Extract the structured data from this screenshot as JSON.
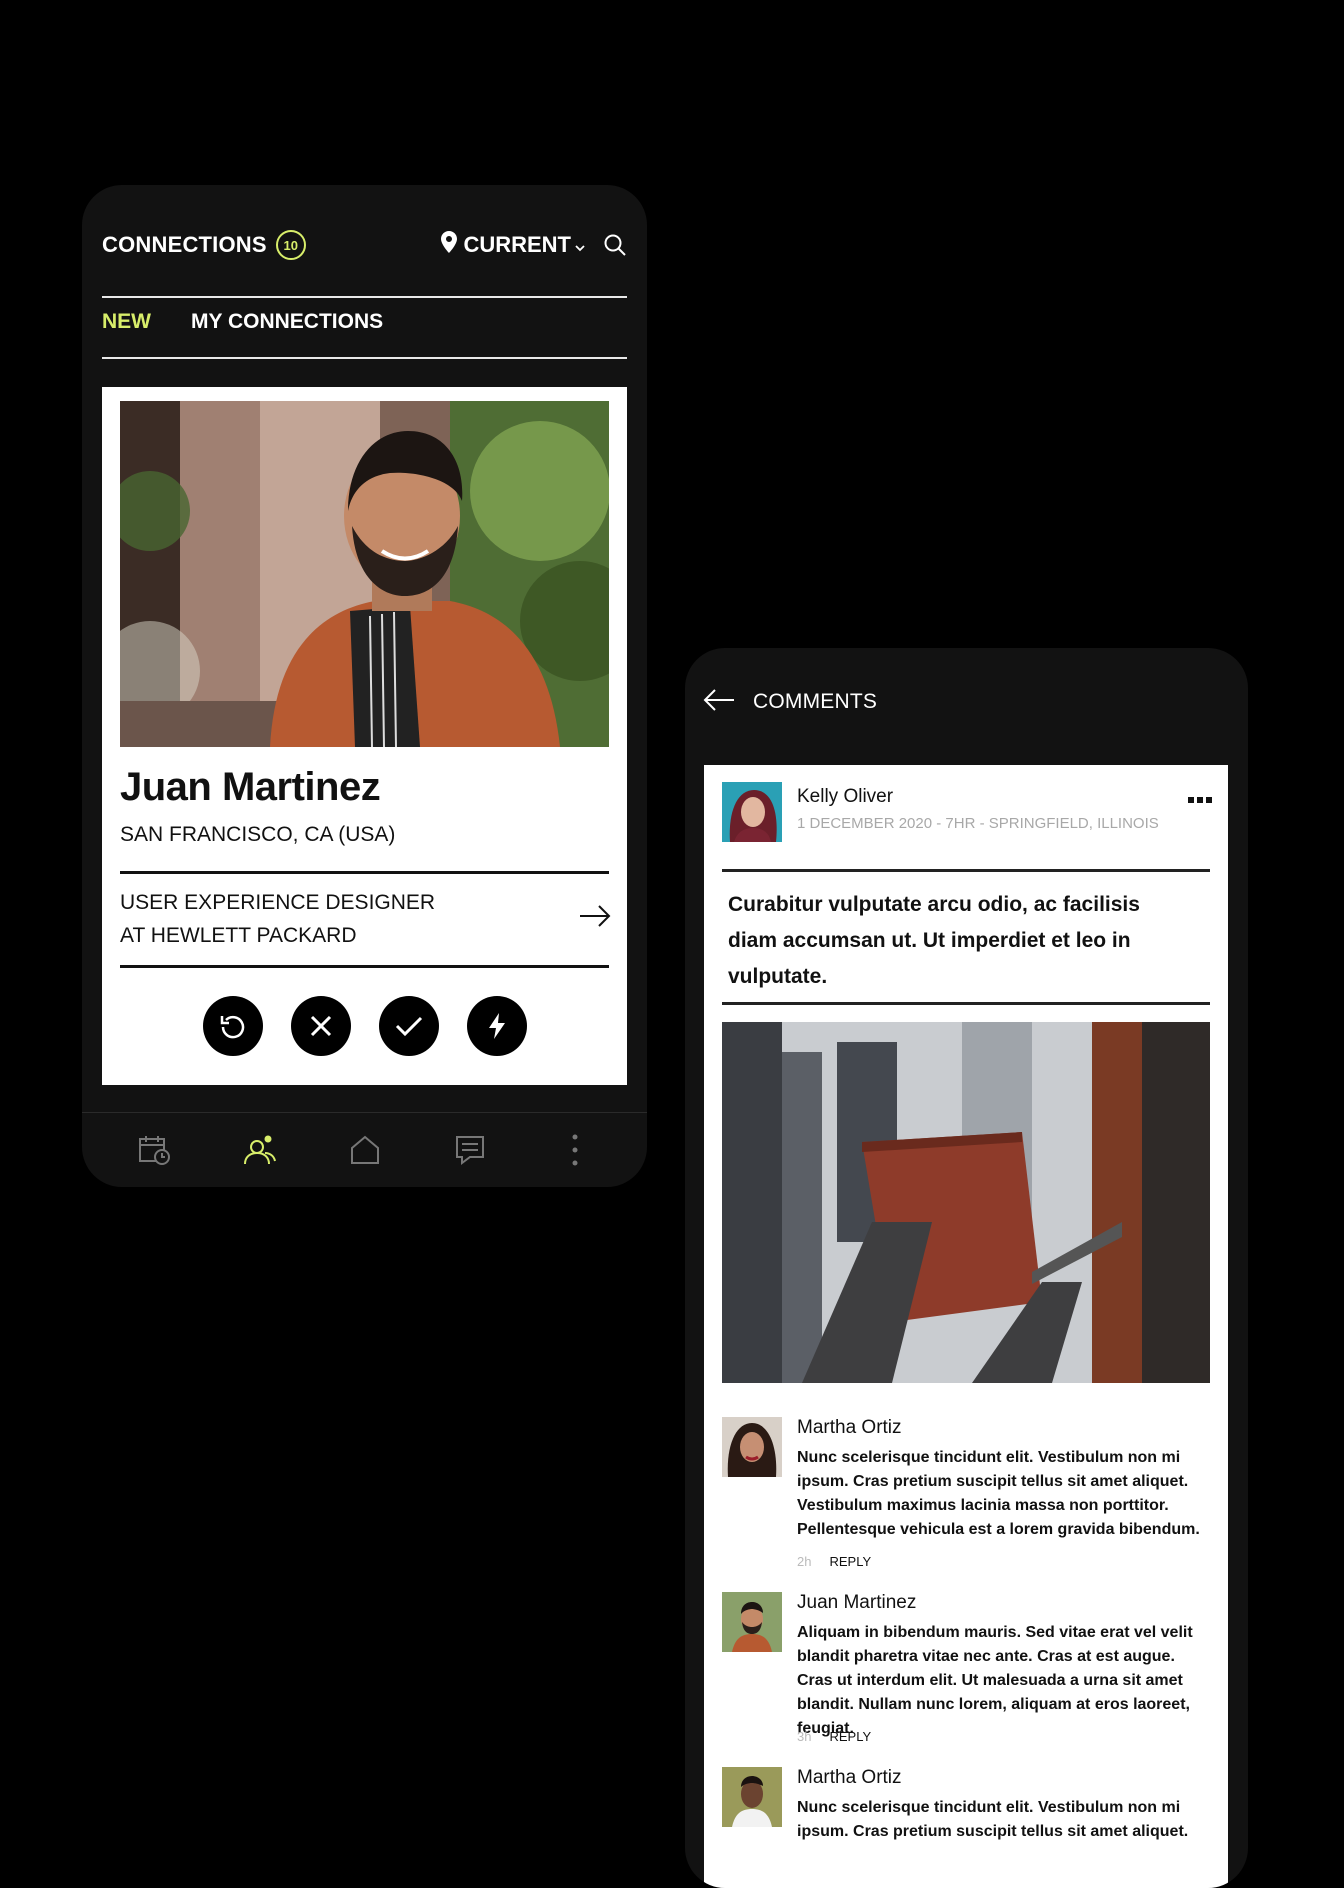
{
  "connections": {
    "title": "CONNECTIONS",
    "count": "10",
    "location_label": "CURRENT",
    "tabs": {
      "new": "NEW",
      "mine": "MY CONNECTIONS"
    },
    "profile": {
      "name": "Juan Martinez",
      "location": "SAN FRANCISCO, CA (USA)",
      "job_line1": "USER EXPERIENCE DESIGNER",
      "job_line2": "AT HEWLETT PACKARD"
    },
    "nav_icons": [
      "calendar-clock-icon",
      "connections-icon",
      "home-icon",
      "messages-icon",
      "more-vertical-icon"
    ]
  },
  "comments": {
    "title": "COMMENTS",
    "post": {
      "author": "Kelly Oliver",
      "meta": "1 DECEMBER 2020 - 7HR - SPRINGFIELD, ILLINOIS",
      "text": "Curabitur vulputate arcu odio, ac facilisis diam accumsan ut. Ut imperdiet et leo in vulputate."
    },
    "list": [
      {
        "name": "Martha Ortiz",
        "text": "Nunc scelerisque tincidunt elit. Vestibulum non mi ipsum. Cras pretium suscipit tellus sit amet aliquet. Vestibulum maximus lacinia massa non porttitor. Pellentesque vehicula est a lorem gravida bibendum.",
        "age": "2h",
        "reply": "REPLY"
      },
      {
        "name": "Juan Martinez",
        "text": "Aliquam in bibendum mauris. Sed vitae erat vel velit blandit pharetra vitae nec ante. Cras at est augue. Cras ut interdum elit. Ut malesuada a urna sit amet blandit. Nullam nunc lorem, aliquam at eros laoreet, feugiat.",
        "age": "3h",
        "reply": "REPLY"
      },
      {
        "name": "Martha Ortiz",
        "text": "Nunc scelerisque tincidunt elit. Vestibulum non mi ipsum. Cras pretium suscipit tellus sit amet aliquet.",
        "age": "",
        "reply": ""
      }
    ]
  },
  "colors": {
    "accent": "#d8ee6a",
    "phone_bg": "#121212",
    "page_bg": "#000000"
  }
}
